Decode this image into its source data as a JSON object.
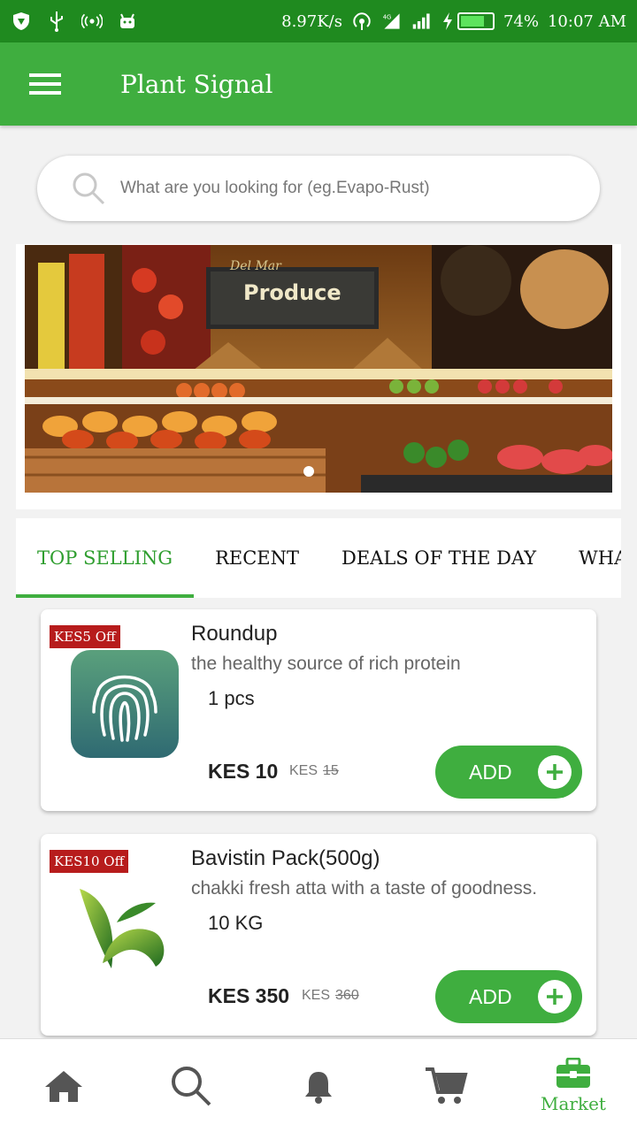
{
  "status_bar": {
    "speed": "8.97K/s",
    "battery": "74%",
    "time": "10:07 AM",
    "colors": {
      "background": "#1f8a1f"
    }
  },
  "app_bar": {
    "title": "Plant Signal",
    "background": "#3fae3f"
  },
  "search": {
    "placeholder": "What are you looking for (eg.Evapo-Rust)"
  },
  "banner": {
    "sign_text": "Produce",
    "sign_subtext": "Del Mar",
    "active_slide": 1
  },
  "tabs": [
    {
      "label": "TOP SELLING",
      "active": true
    },
    {
      "label": "RECENT",
      "active": false
    },
    {
      "label": "DEALS OF THE DAY",
      "active": false
    },
    {
      "label": "WHAT'S",
      "active": false
    }
  ],
  "products": [
    {
      "badge": "KES5 Off",
      "name": "Roundup",
      "description": "the healthy source of rich protein",
      "quantity": "1 pcs",
      "price": "KES 10",
      "old_currency": "KES",
      "old_price": "15",
      "add_label": "ADD",
      "icon": "fingerprint-icon"
    },
    {
      "badge": "KES10 Off",
      "name": "Bavistin Pack(500g)",
      "description": "chakki fresh atta with a taste of goodness.",
      "quantity": "10 KG",
      "price": "KES 350",
      "old_currency": "KES",
      "old_price": "360",
      "add_label": "ADD",
      "icon": "leaf-logo-icon"
    }
  ],
  "bottom_nav": [
    {
      "icon": "home-icon",
      "label": ""
    },
    {
      "icon": "search-icon",
      "label": ""
    },
    {
      "icon": "bell-icon",
      "label": ""
    },
    {
      "icon": "cart-icon",
      "label": ""
    },
    {
      "icon": "briefcase-icon",
      "label": "Market",
      "active": true
    }
  ]
}
